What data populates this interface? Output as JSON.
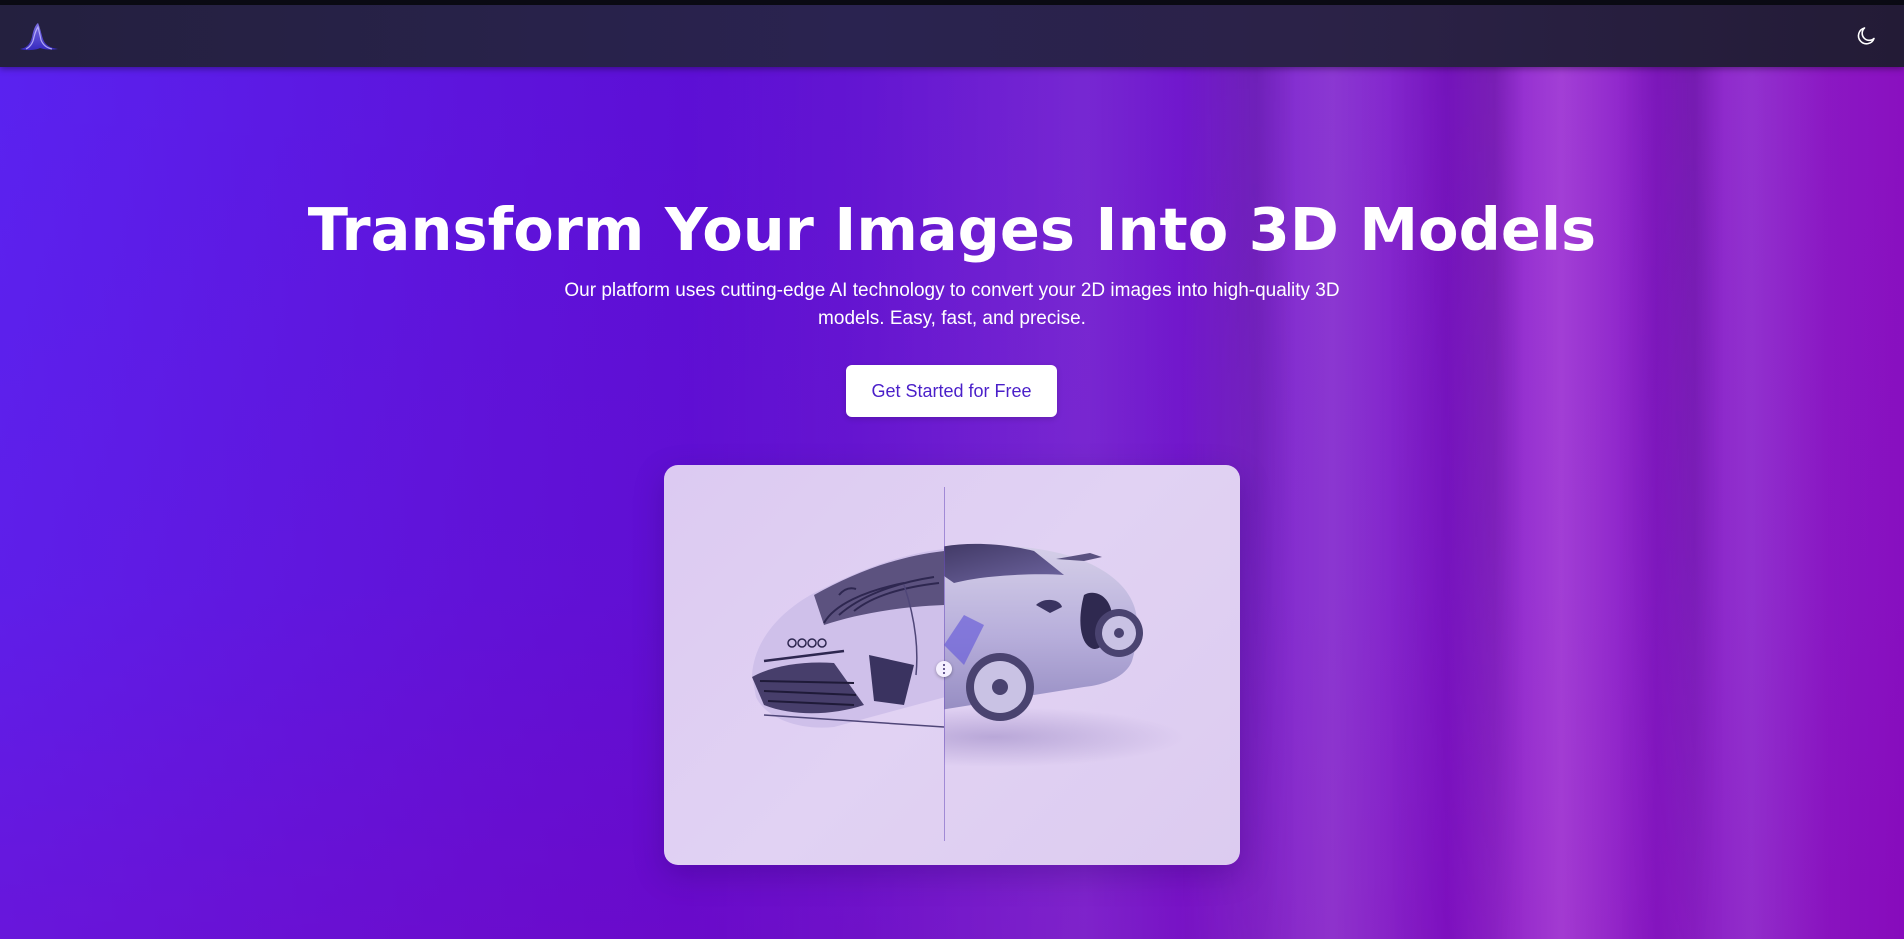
{
  "navbar": {
    "logo_icon": "mountain-wave-logo-icon",
    "theme_toggle_icon": "moon-icon"
  },
  "hero": {
    "title": "Transform Your Images Into 3D Models",
    "subtitle": "Our platform uses cutting-edge AI technology to convert your 2D images into high-quality 3D models. Easy, fast, and precise.",
    "cta_label": "Get Started for Free"
  },
  "comparison": {
    "left_image": "car-sketch",
    "right_image": "car-3d-render",
    "handle_icon": "vertical-dots-icon",
    "split_fraction": 0.49
  },
  "colors": {
    "brand_purple": "#5b1fe6",
    "cta_text": "#4a1fc9",
    "navbar_bg": "#2a2350"
  }
}
